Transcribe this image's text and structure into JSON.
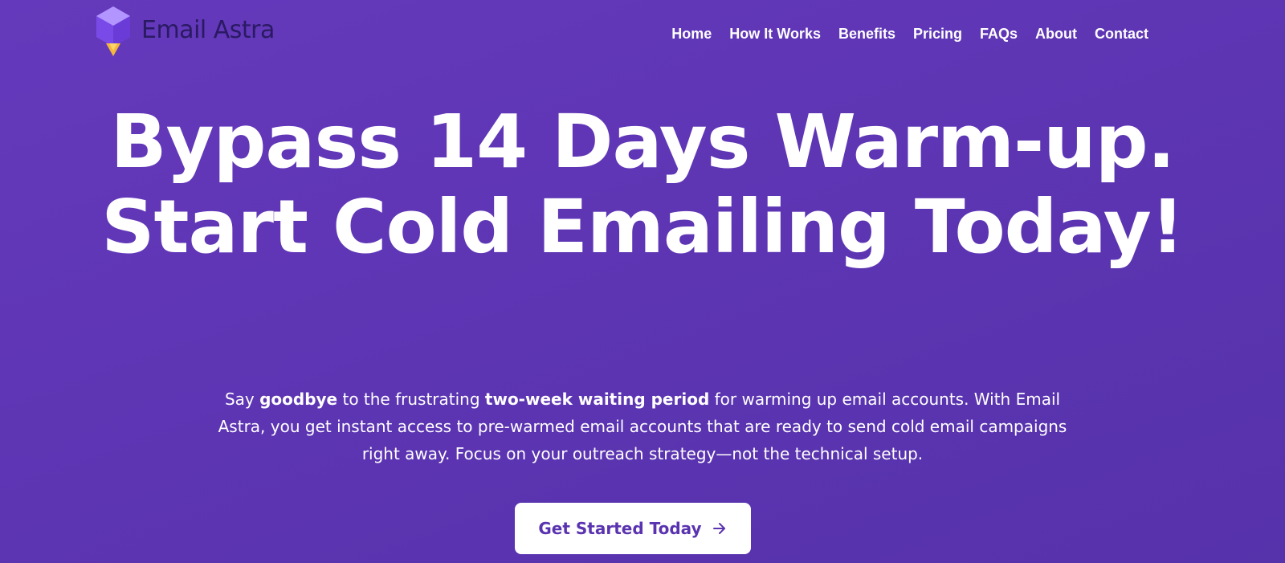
{
  "brand": {
    "name": "Email Astra",
    "colors": {
      "background": "#5f37b5",
      "logo_text": "#2a1a63",
      "logo_purple": "#8a5cf5",
      "logo_gold": "#f5b73b",
      "cta_text": "#5a33b0"
    }
  },
  "nav": {
    "items": [
      {
        "label": "Home"
      },
      {
        "label": "How It Works"
      },
      {
        "label": "Benefits"
      },
      {
        "label": "Pricing"
      },
      {
        "label": "FAQs"
      },
      {
        "label": "About"
      },
      {
        "label": "Contact"
      }
    ]
  },
  "hero": {
    "title": "Bypass 14 Days Warm-up. Start Cold Emailing Today!",
    "subtitle": {
      "part1": "Say ",
      "bold1": "goodbye",
      "part2": " to the frustrating ",
      "bold2": "two-week waiting period",
      "part3": " for warming up email accounts. With Email Astra, you get instant access to pre-warmed email accounts that are ready to send cold email campaigns right away. Focus on your outreach strategy—not the technical setup."
    },
    "cta": {
      "label": "Get Started Today",
      "icon": "arrow-right-icon"
    }
  }
}
